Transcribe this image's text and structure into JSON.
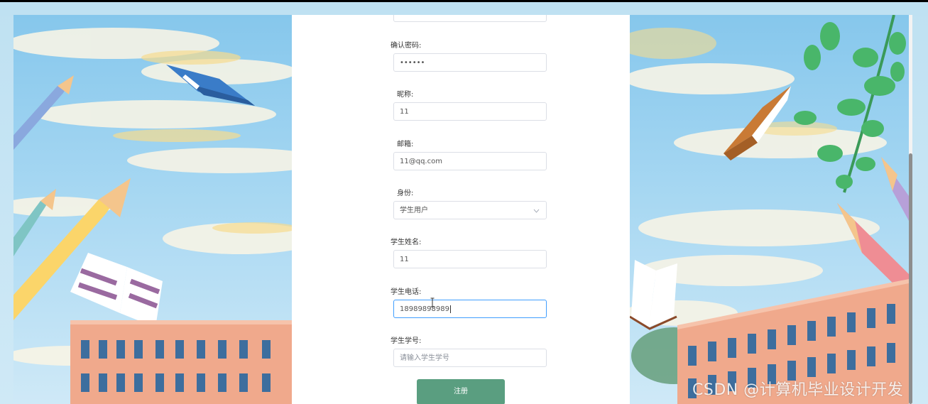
{
  "form": {
    "fields": [
      {
        "label": "确认密码:",
        "value": "••••••",
        "placeholder": ""
      },
      {
        "label": "昵称:",
        "value": "11",
        "placeholder": ""
      },
      {
        "label": "邮箱:",
        "value": "11@qq.com",
        "placeholder": ""
      },
      {
        "label": "身份:",
        "value": "学生用户",
        "placeholder": ""
      },
      {
        "label": "学生姓名:",
        "value": "11",
        "placeholder": ""
      },
      {
        "label": "学生电话:",
        "value": "18989898989",
        "placeholder": ""
      },
      {
        "label": "学生学号:",
        "value": "",
        "placeholder": "请输入学生学号"
      }
    ],
    "submit_label": "注册"
  },
  "watermark": "CSDN @计算机毕业设计开发",
  "colors": {
    "button": "#5a9e80",
    "focus_border": "#409eff",
    "sky": "#86c7ec",
    "building": "#f0a98c"
  },
  "icons": [
    "chevron-down-icon",
    "text-cursor-icon"
  ]
}
